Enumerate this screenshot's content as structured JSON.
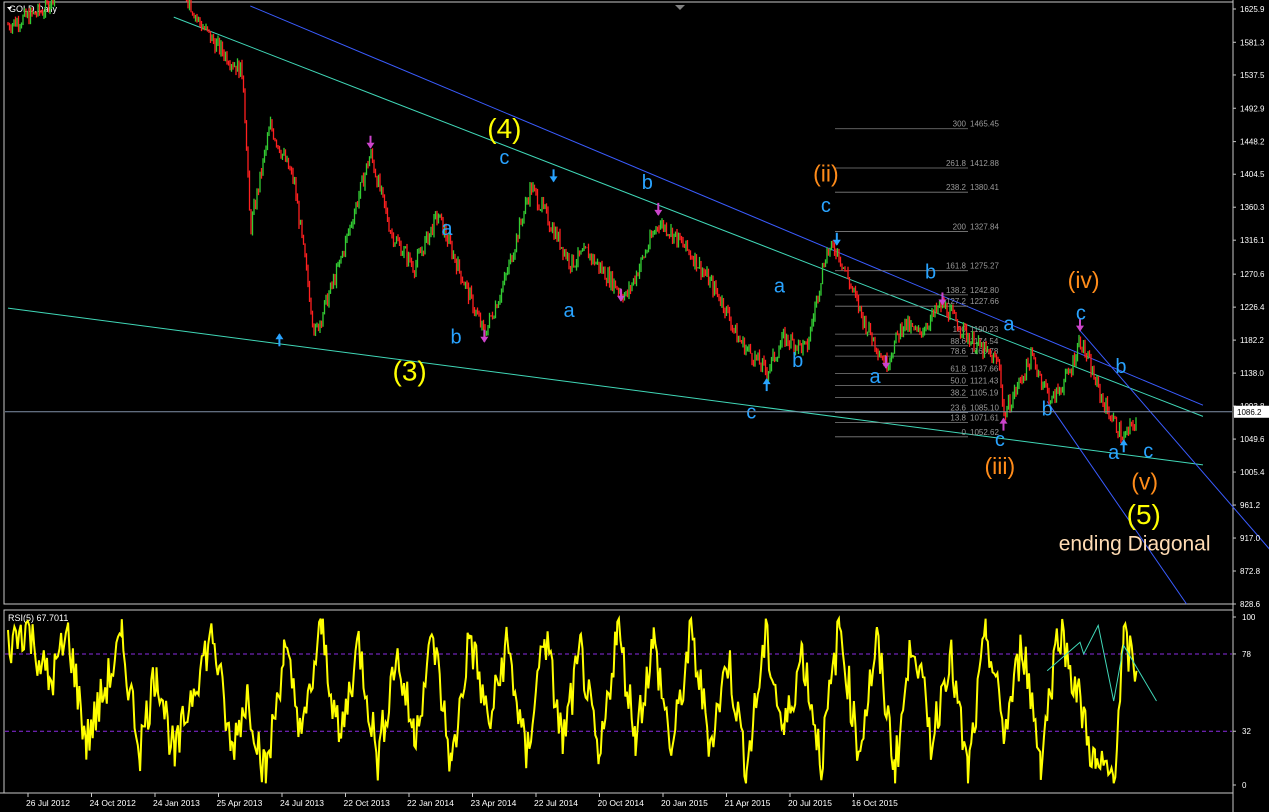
{
  "chart_data": {
    "type": "line",
    "title": "GOLD,Daily",
    "symbol": "GOLD",
    "timeframe": "Daily",
    "y_ticks": [
      "1625.9",
      "1581.3",
      "1537.5",
      "1492.9",
      "1448.2",
      "1404.5",
      "1360.3",
      "1316.1",
      "1270.6",
      "1226.4",
      "1182.2",
      "1138.0",
      "1093.8",
      "1049.6",
      "1005.4",
      "961.2",
      "917.0",
      "872.8",
      "828.6"
    ],
    "ylim": [
      828.6,
      1625.9
    ],
    "x_ticks": [
      "26 Jul 2012",
      "24 Oct 2012",
      "24 Jan 2013",
      "25 Apr 2013",
      "24 Jul 2013",
      "22 Oct 2013",
      "22 Jan 2014",
      "23 Apr 2014",
      "22 Jul 2014",
      "20 Oct 2014",
      "20 Jan 2015",
      "21 Apr 2015",
      "20 Jul 2015",
      "16 Oct 2015"
    ],
    "current_price": {
      "label": "1086.2",
      "value": 1086.2
    },
    "series": [
      {
        "name": "GOLD",
        "color": "#33cc33",
        "down_color": "#ff2020",
        "x": [
          "2012-07-26",
          "2012-09-05",
          "2012-10-05",
          "2012-11-20",
          "2012-12-10",
          "2013-01-24",
          "2013-02-20",
          "2013-03-10",
          "2013-04-10",
          "2013-04-18",
          "2013-05-10",
          "2013-06-05",
          "2013-06-28",
          "2013-07-24",
          "2013-08-28",
          "2013-09-20",
          "2013-10-15",
          "2013-11-10",
          "2013-12-31",
          "2014-01-22",
          "2014-02-20",
          "2014-03-17",
          "2014-04-05",
          "2014-04-23",
          "2014-05-10",
          "2014-06-05",
          "2014-07-10",
          "2014-07-22",
          "2014-08-20",
          "2014-09-20",
          "2014-10-05",
          "2014-11-06",
          "2014-11-25",
          "2014-12-20",
          "2015-01-10",
          "2015-01-22",
          "2015-02-20",
          "2015-03-17",
          "2015-04-05",
          "2015-04-21",
          "2015-05-18",
          "2015-06-20",
          "2015-07-20",
          "2015-07-24",
          "2015-08-24",
          "2015-09-15",
          "2015-10-05",
          "2015-10-16",
          "2015-11-10",
          "2015-12-03",
          "2015-12-17"
        ],
        "values": [
          1605,
          1625,
          1700,
          1760,
          1700,
          1680,
          1610,
          1580,
          1540,
          1330,
          1470,
          1395,
          1190,
          1280,
          1432,
          1325,
          1280,
          1350,
          1190,
          1260,
          1388,
          1330,
          1285,
          1300,
          1275,
          1240,
          1340,
          1330,
          1290,
          1230,
          1185,
          1140,
          1185,
          1170,
          1300,
          1305,
          1210,
          1150,
          1205,
          1190,
          1230,
          1180,
          1150,
          1080,
          1160,
          1100,
          1140,
          1184,
          1100,
          1050,
          1075
        ]
      }
    ],
    "fib_levels": [
      {
        "ratio": "300",
        "price": "1465.45"
      },
      {
        "ratio": "261.8",
        "price": "1412.88"
      },
      {
        "ratio": "238.2",
        "price": "1380.41"
      },
      {
        "ratio": "200",
        "price": "1327.84"
      },
      {
        "ratio": "161.8",
        "price": "1275.27"
      },
      {
        "ratio": "138.2",
        "price": "1242.80"
      },
      {
        "ratio": "127.2",
        "price": "1227.66"
      },
      {
        "ratio": "100",
        "price": "1190.23"
      },
      {
        "ratio": "88.6",
        "price": "1174.54"
      },
      {
        "ratio": "78.6",
        "price": "1160.78"
      },
      {
        "ratio": "61.8",
        "price": "1137.66"
      },
      {
        "ratio": "50.0",
        "price": "1121.43"
      },
      {
        "ratio": "38.2",
        "price": "1105.19"
      },
      {
        "ratio": "23.6",
        "price": "1085.10"
      },
      {
        "ratio": "13.8",
        "price": "1071.61"
      },
      {
        "ratio": "0",
        "price": "1052.62"
      }
    ],
    "annotations": [
      {
        "text": "(4)",
        "date": "2014-01-22",
        "price": 1453,
        "color": "#ffff00",
        "size": 28
      },
      {
        "text": "c",
        "date": "2014-01-22",
        "price": 1418,
        "color": "#29a3ff",
        "size": 20
      },
      {
        "text": "a",
        "date": "2013-11-20",
        "price": 1323,
        "color": "#29a3ff",
        "size": 20
      },
      {
        "text": "b",
        "date": "2013-11-30",
        "price": 1178,
        "color": "#29a3ff",
        "size": 20
      },
      {
        "text": "(3)",
        "date": "2013-10-10",
        "price": 1128,
        "color": "#ffff00",
        "size": 28
      },
      {
        "text": "b",
        "date": "2014-06-28",
        "price": 1385,
        "color": "#29a3ff",
        "size": 20
      },
      {
        "text": "a",
        "date": "2014-04-03",
        "price": 1213,
        "color": "#29a3ff",
        "size": 20
      },
      {
        "text": "(ii)",
        "date": "2015-01-10",
        "price": 1395,
        "color": "#ff8c1a",
        "size": 23
      },
      {
        "text": "c",
        "date": "2015-01-10",
        "price": 1354,
        "color": "#29a3ff",
        "size": 20
      },
      {
        "text": "a",
        "date": "2014-11-20",
        "price": 1246,
        "color": "#29a3ff",
        "size": 20
      },
      {
        "text": "b",
        "date": "2014-12-10",
        "price": 1146,
        "color": "#29a3ff",
        "size": 20
      },
      {
        "text": "c",
        "date": "2014-10-20",
        "price": 1077,
        "color": "#29a3ff",
        "size": 20
      },
      {
        "text": "a",
        "date": "2015-03-05",
        "price": 1125,
        "color": "#29a3ff",
        "size": 20
      },
      {
        "text": "b",
        "date": "2015-05-05",
        "price": 1265,
        "color": "#29a3ff",
        "size": 20
      },
      {
        "text": "a",
        "date": "2015-07-30",
        "price": 1195,
        "color": "#29a3ff",
        "size": 20
      },
      {
        "text": "c",
        "date": "2015-07-20",
        "price": 1040,
        "color": "#29a3ff",
        "size": 20
      },
      {
        "text": "(iii)",
        "date": "2015-07-20",
        "price": 1003,
        "color": "#ff8c1a",
        "size": 23
      },
      {
        "text": "b",
        "date": "2015-09-10",
        "price": 1081,
        "color": "#29a3ff",
        "size": 20
      },
      {
        "text": "(iv)",
        "date": "2015-10-20",
        "price": 1252,
        "color": "#ff8c1a",
        "size": 23
      },
      {
        "text": "c",
        "date": "2015-10-17",
        "price": 1210,
        "color": "#29a3ff",
        "size": 20
      },
      {
        "text": "b",
        "date": "2015-11-30",
        "price": 1138,
        "color": "#29a3ff",
        "size": 20
      },
      {
        "text": "a",
        "date": "2015-11-22",
        "price": 1023,
        "color": "#29a3ff",
        "size": 20
      },
      {
        "text": "c",
        "date": "2015-12-30",
        "price": 1025,
        "color": "#29a3ff",
        "size": 20
      },
      {
        "text": "(v)",
        "date": "2015-12-26",
        "price": 982,
        "color": "#ff8c1a",
        "size": 23
      },
      {
        "text": "(5)",
        "date": "2015-12-25",
        "price": 936,
        "color": "#ffff00",
        "size": 28
      },
      {
        "text": "ending Diagonal",
        "date": "2015-12-15",
        "price": 900,
        "color": "#ffdcb4",
        "size": 21
      }
    ],
    "pivot_arrows": [
      {
        "date": "2013-05-20",
        "price": 1190,
        "dir": "up",
        "color": "#29a3ff"
      },
      {
        "date": "2013-08-28",
        "price": 1440,
        "dir": "down",
        "color": "#cc44cc"
      },
      {
        "date": "2013-12-31",
        "price": 1180,
        "dir": "down",
        "color": "#cc44cc"
      },
      {
        "date": "2014-03-17",
        "price": 1395,
        "dir": "down",
        "color": "#29a3ff"
      },
      {
        "date": "2014-05-30",
        "price": 1235,
        "dir": "down",
        "color": "#cc44cc"
      },
      {
        "date": "2014-07-10",
        "price": 1350,
        "dir": "down",
        "color": "#cc44cc"
      },
      {
        "date": "2014-11-06",
        "price": 1130,
        "dir": "up",
        "color": "#29a3ff"
      },
      {
        "date": "2015-01-22",
        "price": 1310,
        "dir": "down",
        "color": "#29a3ff"
      },
      {
        "date": "2015-03-17",
        "price": 1145,
        "dir": "down",
        "color": "#cc44cc"
      },
      {
        "date": "2015-05-18",
        "price": 1230,
        "dir": "down",
        "color": "#cc44cc"
      },
      {
        "date": "2015-07-24",
        "price": 1077,
        "dir": "up",
        "color": "#cc44cc"
      },
      {
        "date": "2015-10-16",
        "price": 1195,
        "dir": "down",
        "color": "#cc44cc"
      },
      {
        "date": "2015-12-03",
        "price": 1048,
        "dir": "up",
        "color": "#29a3ff"
      }
    ],
    "trendlines": [
      {
        "from": [
          "2013-01-24",
          1615
        ],
        "to": [
          "2016-02-28",
          1080
        ],
        "color": "#40d8b8"
      },
      {
        "from": [
          "2012-07-26",
          1225
        ],
        "to": [
          "2016-02-28",
          1015
        ],
        "color": "#40d8b8"
      },
      {
        "from": [
          "2013-04-18",
          1630
        ],
        "to": [
          "2016-02-28",
          1095
        ],
        "color": "#3a5cff"
      },
      {
        "from": [
          "2015-10-16",
          1195
        ],
        "to": [
          "2016-06-10",
          860
        ],
        "color": "#3a5cff"
      },
      {
        "from": [
          "2015-09-10",
          1100
        ],
        "to": [
          "2016-02-10",
          828.6
        ],
        "color": "#3a5cff"
      }
    ],
    "rsi": {
      "title": "RSI(5) 67.7011",
      "period": 5,
      "value": 67.7011,
      "ylim": [
        0,
        100
      ],
      "y_ticks": [
        "100",
        "78",
        "32",
        "0"
      ],
      "levels": [
        78,
        32
      ],
      "color": "#ffff00",
      "x": [
        "2012-07-26",
        "2012-08-15",
        "2012-09-10",
        "2012-09-30",
        "2012-10-20",
        "2012-11-08",
        "2012-11-28",
        "2012-12-18",
        "2013-01-05",
        "2013-01-25",
        "2013-02-15",
        "2013-03-08",
        "2013-03-28",
        "2013-04-15",
        "2013-05-05",
        "2013-05-25",
        "2013-06-15",
        "2013-07-05",
        "2013-07-25",
        "2013-08-15",
        "2013-09-05",
        "2013-09-25",
        "2013-10-15",
        "2013-11-05",
        "2013-11-25",
        "2013-12-15",
        "2014-01-05",
        "2014-01-25",
        "2014-02-15",
        "2014-03-07",
        "2014-03-27",
        "2014-04-16",
        "2014-05-06",
        "2014-05-26",
        "2014-06-15",
        "2014-07-05",
        "2014-07-25",
        "2014-08-15",
        "2014-09-05",
        "2014-09-25",
        "2014-10-15",
        "2014-11-05",
        "2014-11-25",
        "2014-12-15",
        "2015-01-05",
        "2015-01-25",
        "2015-02-15",
        "2015-03-07",
        "2015-03-27",
        "2015-04-16",
        "2015-05-06",
        "2015-05-26",
        "2015-06-15",
        "2015-07-05",
        "2015-07-25",
        "2015-08-14",
        "2015-09-03",
        "2015-09-23",
        "2015-10-13",
        "2015-11-02",
        "2015-11-22",
        "2015-12-03",
        "2015-12-17"
      ],
      "values": [
        82,
        95,
        60,
        90,
        25,
        55,
        85,
        22,
        70,
        15,
        60,
        90,
        20,
        55,
        5,
        80,
        30,
        95,
        25,
        85,
        15,
        78,
        30,
        88,
        10,
        90,
        35,
        85,
        15,
        92,
        25,
        80,
        10,
        95,
        30,
        85,
        20,
        90,
        25,
        75,
        10,
        88,
        30,
        80,
        15,
        95,
        20,
        85,
        10,
        90,
        25,
        80,
        5,
        92,
        30,
        85,
        15,
        95,
        55,
        10,
        5,
        85,
        68
      ],
      "divergence_lines": [
        {
          "points": [
            [
              "2015-09-10",
              68
            ],
            [
              "2015-10-16",
              85
            ],
            [
              "2015-10-20",
              78
            ],
            [
              "2015-11-05",
              95
            ],
            [
              "2015-11-22",
              50
            ],
            [
              "2015-12-03",
              83
            ],
            [
              "2016-01-08",
              50
            ]
          ],
          "color": "#40d8b8"
        }
      ]
    }
  }
}
